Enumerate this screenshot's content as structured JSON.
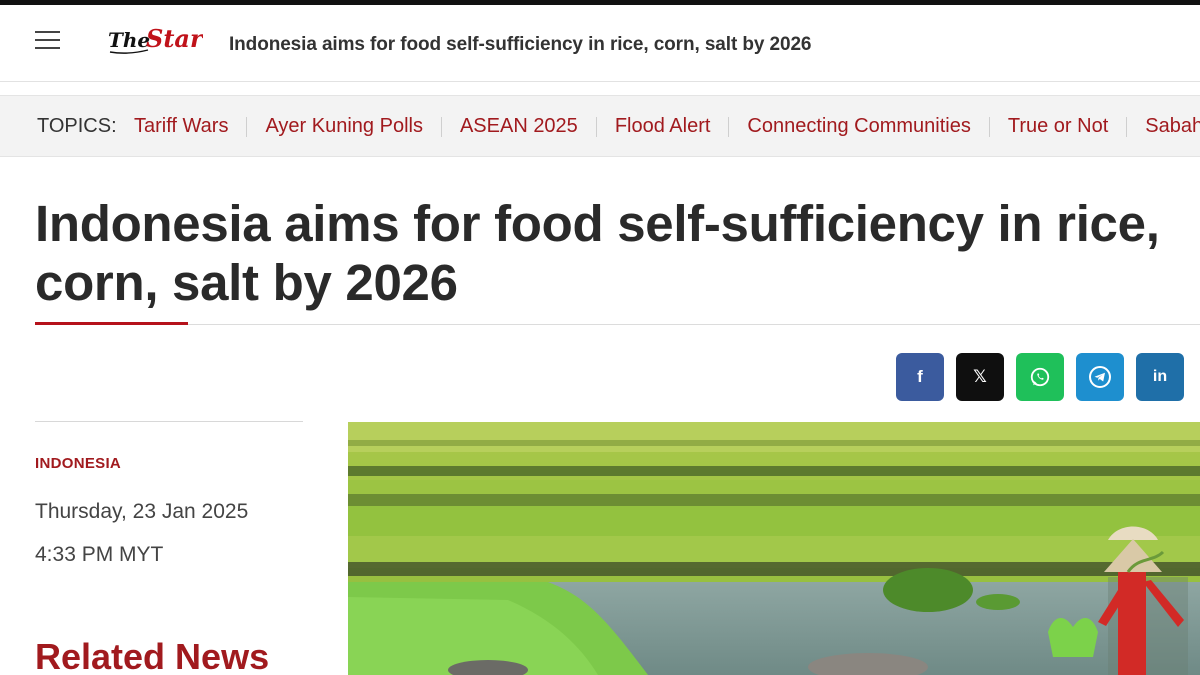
{
  "header": {
    "logo_text": "TheStar",
    "title": "Indonesia aims for food self-sufficiency in rice, corn, salt by 2026"
  },
  "topics": {
    "label": "TOPICS:",
    "items": [
      "Tariff Wars",
      "Ayer Kuning Polls",
      "ASEAN 2025",
      "Flood Alert",
      "Connecting Communities",
      "True or Not",
      "Sabah & S"
    ]
  },
  "article": {
    "headline_line1": "Indonesia aims for food self-sufficiency in rice,",
    "headline_line2": "corn, salt by 2026",
    "category": "INDONESIA",
    "date": "Thursday, 23 Jan 2025",
    "time": "4:33 PM MYT"
  },
  "share": {
    "facebook": "f",
    "x": "𝕏",
    "linkedin": "in"
  },
  "sidebar": {
    "related_heading": "Related News"
  },
  "colors": {
    "accent": "#a11a1e",
    "facebook": "#3b5b9e",
    "x": "#0f0f0f",
    "whatsapp": "#1fc05a",
    "telegram": "#1e8fcf",
    "linkedin": "#1f6fa8"
  }
}
